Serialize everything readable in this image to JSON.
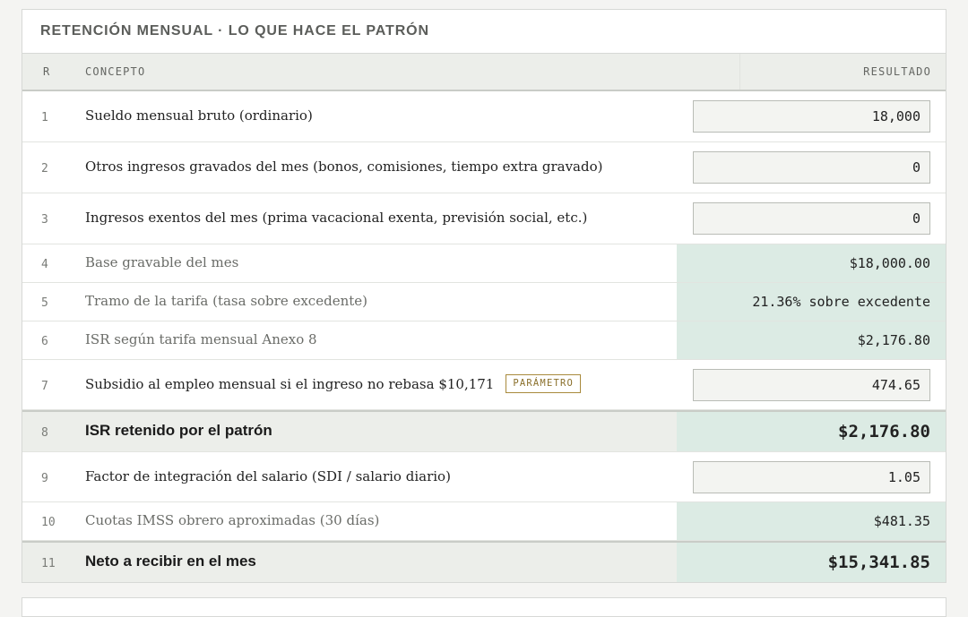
{
  "panel": {
    "title": "RETENCIÓN MENSUAL · LO QUE HACE EL PATRÓN",
    "columns": {
      "r": "R",
      "concept": "CONCEPTO",
      "result": "RESULTADO"
    }
  },
  "rows": [
    {
      "r": "1",
      "concept": "Sueldo mensual bruto (ordinario)",
      "value": "18,000"
    },
    {
      "r": "2",
      "concept": "Otros ingresos gravados del mes (bonos, comisiones, tiempo extra gravado)",
      "value": "0"
    },
    {
      "r": "3",
      "concept": "Ingresos exentos del mes (prima vacacional exenta, previsión social, etc.)",
      "value": "0"
    },
    {
      "r": "4",
      "concept": "Base gravable del mes",
      "value": "$18,000.00"
    },
    {
      "r": "5",
      "concept": "Tramo de la tarifa (tasa sobre excedente)",
      "value": "21.36% sobre excedente"
    },
    {
      "r": "6",
      "concept": "ISR según tarifa mensual Anexo 8",
      "value": "$2,176.80"
    },
    {
      "r": "7",
      "concept": "Subsidio al empleo mensual si el ingreso no rebasa $10,171",
      "badge": "PARÁMETRO",
      "value": "474.65"
    },
    {
      "r": "8",
      "concept": "ISR retenido por el patrón",
      "value": "$2,176.80"
    },
    {
      "r": "9",
      "concept": "Factor de integración del salario (SDI / salario diario)",
      "value": "1.05"
    },
    {
      "r": "10",
      "concept": "Cuotas IMSS obrero aproximadas (30 días)",
      "value": "$481.35"
    },
    {
      "r": "11",
      "concept": "Neto a recibir en el mes",
      "value": "$15,341.85"
    }
  ],
  "colors": {
    "calc_background": "#dcebe4",
    "total_background": "#eceeea",
    "badge_border": "#a88a3c"
  }
}
